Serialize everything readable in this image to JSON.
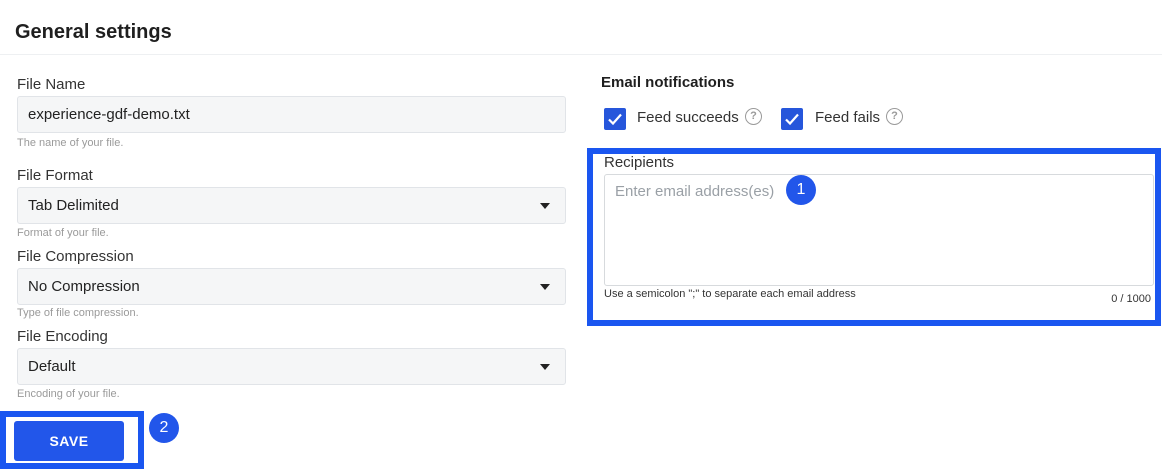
{
  "page": {
    "title": "General settings"
  },
  "left": {
    "file_name": {
      "label": "File Name",
      "value": "experience-gdf-demo.txt",
      "helper": "The name of your file."
    },
    "file_format": {
      "label": "File Format",
      "value": "Tab Delimited",
      "helper": "Format of your file."
    },
    "file_compression": {
      "label": "File Compression",
      "value": "No Compression",
      "helper": "Type of file compression."
    },
    "file_encoding": {
      "label": "File Encoding",
      "value": "Default",
      "helper": "Encoding of your file."
    }
  },
  "notifications": {
    "heading": "Email notifications",
    "options": [
      {
        "label": "Feed succeeds",
        "checked": true
      },
      {
        "label": "Feed fails",
        "checked": true
      }
    ],
    "help_glyph": "?",
    "recipients": {
      "label": "Recipients",
      "value": "",
      "placeholder": "Enter email address(es)",
      "hint": "Use a semicolon \";\" to separate each email address",
      "counter": "0 / 1000"
    }
  },
  "actions": {
    "save_label": "SAVE"
  },
  "annotations": {
    "badge_1": "1",
    "badge_2": "2"
  },
  "colors": {
    "accent": "#2256ea",
    "highlight": "#1a56f0"
  },
  "icons": {
    "dropdown": "caret-down-icon",
    "help": "question-circle-icon",
    "checkbox": "checkmark-icon"
  }
}
